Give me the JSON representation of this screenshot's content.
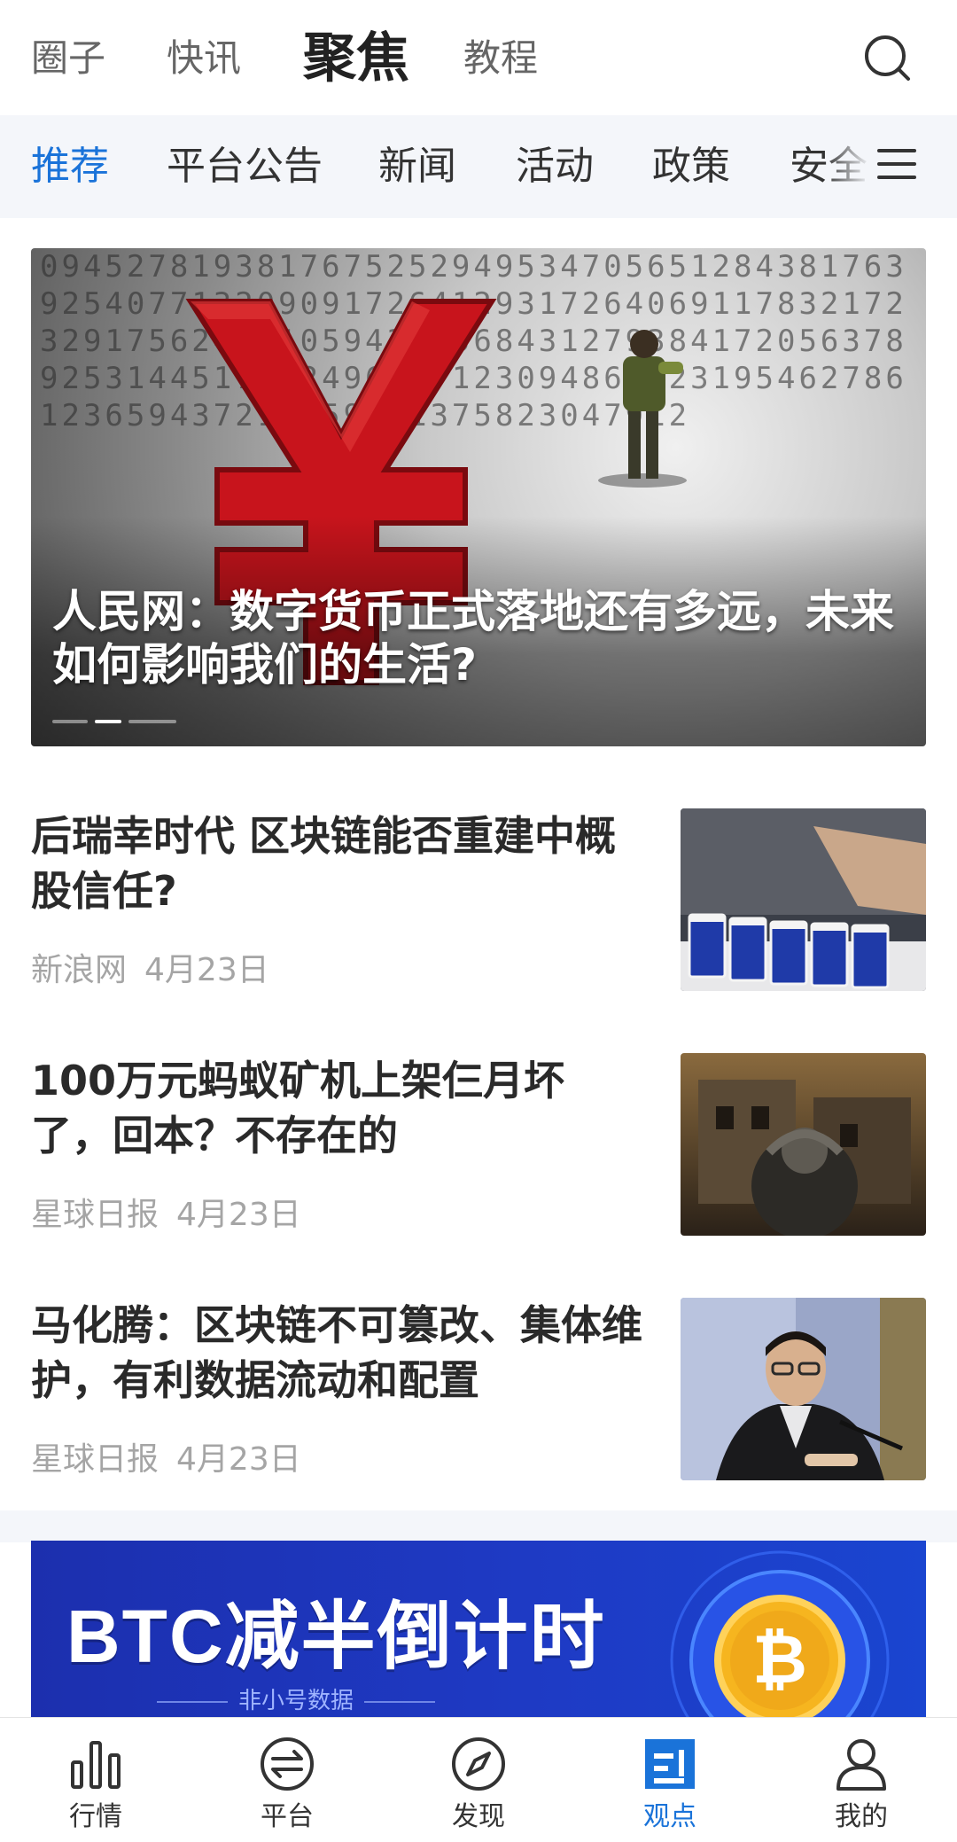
{
  "top_tabs": [
    {
      "label": "圈子"
    },
    {
      "label": "快讯"
    },
    {
      "label": "聚焦",
      "active": true
    },
    {
      "label": "教程"
    }
  ],
  "search": {
    "icon": "search-icon"
  },
  "categories": [
    {
      "label": "推荐",
      "active": true
    },
    {
      "label": "平台公告"
    },
    {
      "label": "新闻"
    },
    {
      "label": "活动"
    },
    {
      "label": "政策"
    },
    {
      "label": "安全"
    }
  ],
  "menu": {
    "icon": "menu-icon"
  },
  "banner": {
    "title": "人民网：数字货币正式落地还有多远，未来如何影响我们的生活?",
    "slide_count": 3,
    "active_slide": 2
  },
  "articles": [
    {
      "title": "后瑞幸时代 区块链能否重建中概股信任?",
      "source": "新浪网",
      "date": "4月23日",
      "thumb": "coffee-cups-image"
    },
    {
      "title": "100万元蚂蚁矿机上架仨月坏了，回本？不存在的",
      "source": "星球日报",
      "date": "4月23日",
      "thumb": "ruined-building-image"
    },
    {
      "title": "马化腾：区块链不可篡改、集体维护，有利数据流动和配置",
      "source": "星球日报",
      "date": "4月23日",
      "thumb": "speaker-portrait-image"
    }
  ],
  "promo": {
    "title": "BTC减半倒计时",
    "subtitle": "非小号数据"
  },
  "bottom_nav": [
    {
      "label": "行情",
      "icon": "chart-icon"
    },
    {
      "label": "平台",
      "icon": "exchange-icon"
    },
    {
      "label": "发现",
      "icon": "compass-icon"
    },
    {
      "label": "观点",
      "icon": "article-icon",
      "active": true
    },
    {
      "label": "我的",
      "icon": "user-icon"
    }
  ],
  "colors": {
    "accent": "#1a73d9",
    "category_bg": "#f4f6fa",
    "meta_text": "#a5a5a5"
  }
}
